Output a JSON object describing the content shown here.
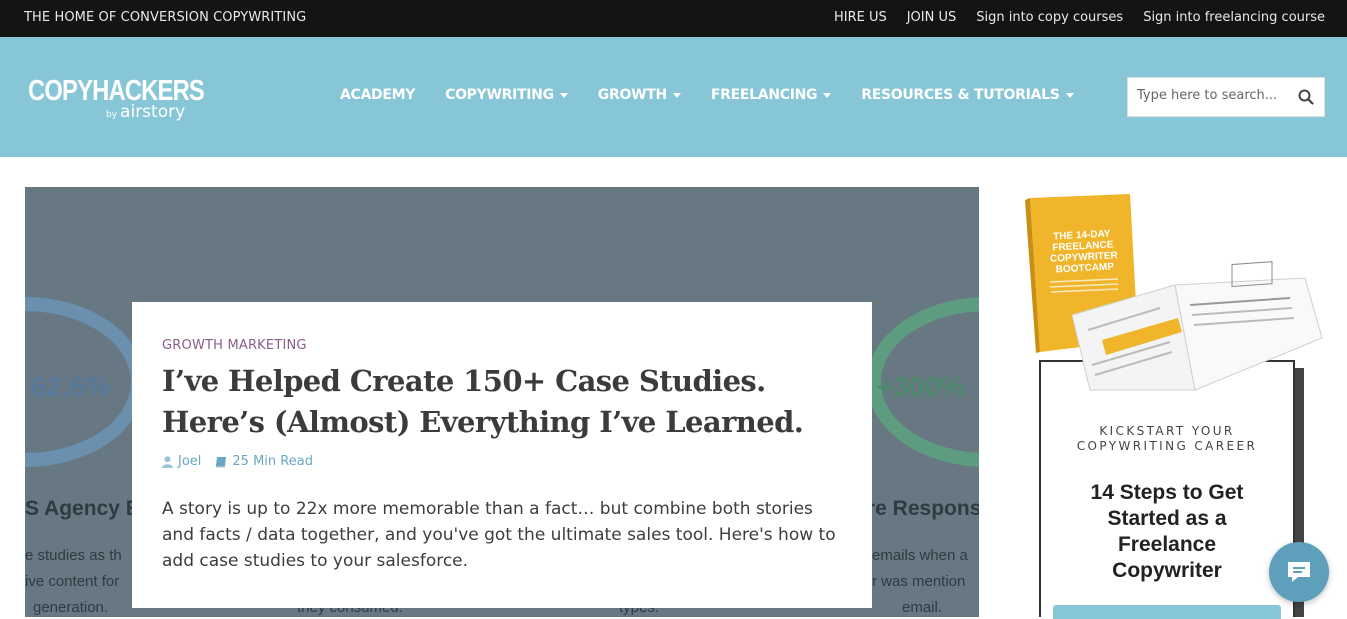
{
  "topbar": {
    "tagline": "THE HOME OF CONVERSION COPYWRITING",
    "links": [
      "HIRE US",
      "JOIN US",
      "Sign into copy courses",
      "Sign into freelancing course"
    ]
  },
  "header": {
    "logo_main": "COPYHACKERS",
    "logo_by": "by",
    "logo_sub": "airstory",
    "nav": [
      {
        "label": "ACADEMY",
        "dropdown": false
      },
      {
        "label": "COPYWRITING",
        "dropdown": true
      },
      {
        "label": "GROWTH",
        "dropdown": true
      },
      {
        "label": "FREELANCING",
        "dropdown": true
      },
      {
        "label": "RESOURCES & TUTORIALS",
        "dropdown": true
      }
    ],
    "search": {
      "placeholder": "Type here to search...",
      "icon": "search-icon"
    }
  },
  "hero": {
    "background_color": "#687883",
    "stat_left": "62.6%",
    "stat_right": "+300%",
    "ghost_left_heading": "S Agency Ex",
    "ghost_right_heading": "re Respons",
    "ghost_left_lines": [
      "e studies as th",
      "ive content for",
      "generation."
    ],
    "ghost_right_lines": [
      "emails when a",
      "r was mention",
      "email."
    ],
    "ghost_mid_lines": [
      "they consumed.",
      "types."
    ]
  },
  "article": {
    "category": "GROWTH MARKETING",
    "title": "I’ve Helped Create 150+ Case Studies. Here’s (Almost) Everything I’ve Learned.",
    "author": "Joel",
    "read_time": "25 Min Read",
    "excerpt": "A story is up to 22x more memorable than a fact… but combine both stories and facts / data together, and you've got the ultimate sales tool. Here's how to add case studies to your salesforce."
  },
  "sidebar": {
    "book_cover_lines": [
      "THE 14-DAY",
      "FREELANCE",
      "COPYWRITER",
      "BOOTCAMP"
    ],
    "kicker_lines": [
      "KICKSTART YOUR",
      "COPYWRITING CAREER"
    ],
    "headline_lines": [
      "14 Steps to Get",
      "Started as a",
      "Freelance",
      "Copywriter"
    ]
  },
  "chat": {
    "icon": "chat-bubble-icon"
  },
  "colors": {
    "header": "#86c6d6",
    "topbar": "#141414",
    "category": "#8a5d8c",
    "meta": "#6aa7c3",
    "book": "#f0b52a"
  }
}
